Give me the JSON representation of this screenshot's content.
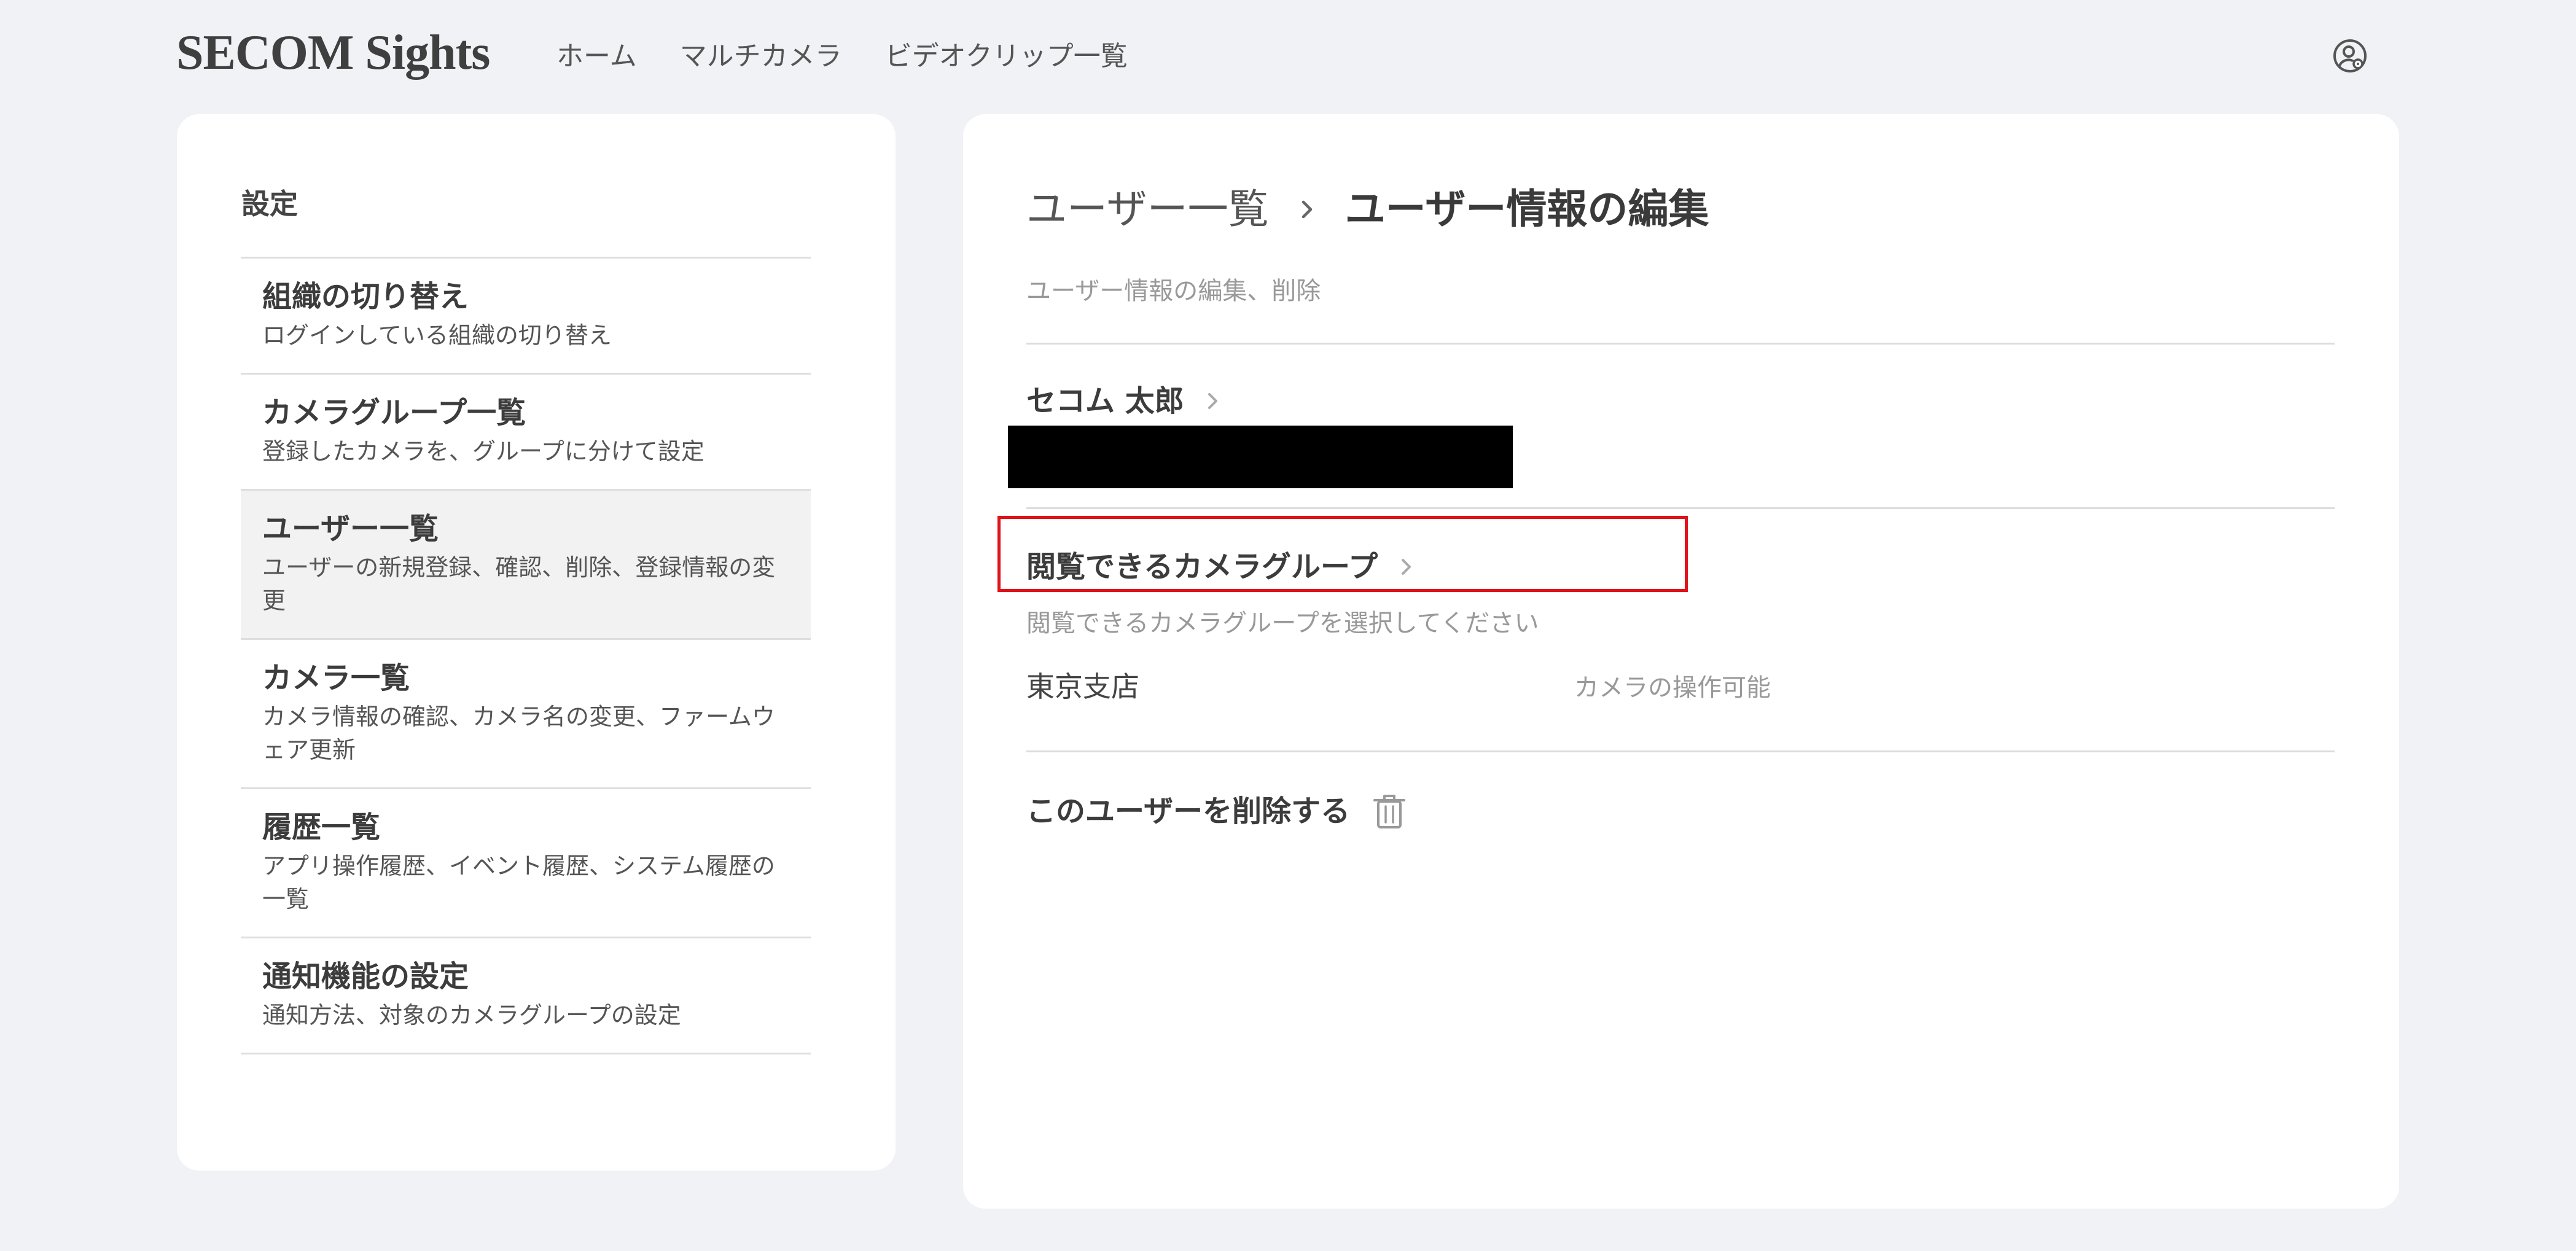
{
  "header": {
    "logo": "SECOM Sights",
    "nav": [
      "ホーム",
      "マルチカメラ",
      "ビデオクリップ一覧"
    ],
    "account_icon": "user-gear-icon"
  },
  "sidebar": {
    "title": "設定",
    "items": [
      {
        "title": "組織の切り替え",
        "desc": "ログインしている組織の切り替え",
        "active": false
      },
      {
        "title": "カメラグループ一覧",
        "desc": "登録したカメラを、グループに分けて設定",
        "active": false
      },
      {
        "title": "ユーザー一覧",
        "desc": "ユーザーの新規登録、確認、削除、登録情報の変更",
        "active": true
      },
      {
        "title": "カメラ一覧",
        "desc": "カメラ情報の確認、カメラ名の変更、ファームウェア更新",
        "active": false
      },
      {
        "title": "履歴一覧",
        "desc": "アプリ操作履歴、イベント履歴、システム履歴の一覧",
        "active": false
      },
      {
        "title": "通知機能の設定",
        "desc": "通知方法、対象のカメラグループの設定",
        "active": false
      }
    ]
  },
  "main": {
    "breadcrumb_parent": "ユーザー一覧",
    "breadcrumb_current": "ユーザー情報の編集",
    "description": "ユーザー情報の編集、削除",
    "user_name": "セコム 太郎",
    "camera_group": {
      "title": "閲覧できるカメラグループ",
      "desc": "閲覧できるカメラグループを選択してください",
      "name": "東京支店",
      "permission": "カメラの操作可能"
    },
    "delete_label": "このユーザーを削除する"
  },
  "colors": {
    "background": "#f1f2f6",
    "card": "#ffffff",
    "highlight": "#e0121a",
    "active_item": "#f2f2f2"
  }
}
